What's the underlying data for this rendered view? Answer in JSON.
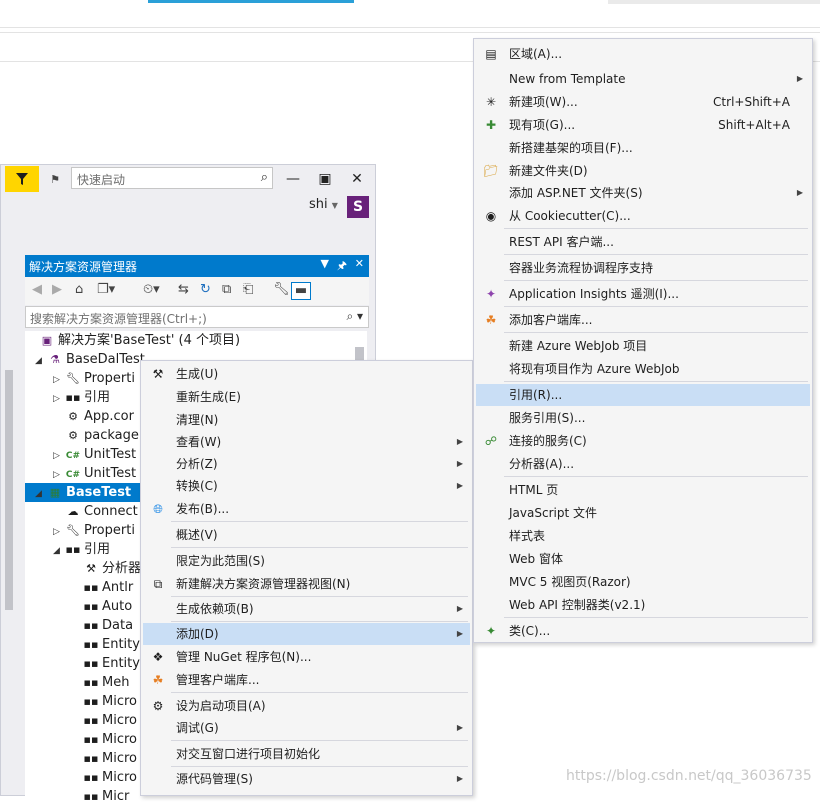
{
  "window": {
    "quick_launch_placeholder": "快速启动",
    "user_name": "shi",
    "avatar_letter": "S",
    "accent_color": "#007acc",
    "filter_color": "#ffd500"
  },
  "solution_explorer": {
    "title": "解决方案资源管理器",
    "search_placeholder": "搜索解决方案资源管理器(Ctrl+;)",
    "tree": [
      {
        "label": "解决方案'BaseTest' (4 个项目)",
        "icon": "solution-icon"
      },
      {
        "label": "BaseDalTest",
        "icon": "test-project-icon"
      },
      {
        "label": "Properti",
        "icon": "wrench-icon"
      },
      {
        "label": "引用",
        "icon": "references-icon"
      },
      {
        "label": "App.cor",
        "icon": "config-icon"
      },
      {
        "label": "package",
        "icon": "config-icon"
      },
      {
        "label": "UnitTest",
        "icon": "csharp-icon"
      },
      {
        "label": "UnitTest",
        "icon": "csharp-icon"
      },
      {
        "label": "BaseTest",
        "icon": "web-project-icon"
      },
      {
        "label": "Connect",
        "icon": "connected-services-icon"
      },
      {
        "label": "Properti",
        "icon": "wrench-icon"
      },
      {
        "label": "引用",
        "icon": "references-icon"
      },
      {
        "label": "分析器",
        "icon": "analyzer-icon"
      },
      {
        "label": "Antlr",
        "icon": "assembly-icon"
      },
      {
        "label": "Auto",
        "icon": "assembly-icon"
      },
      {
        "label": "Data",
        "icon": "assembly-icon"
      },
      {
        "label": "Entity",
        "icon": "assembly-icon"
      },
      {
        "label": "Entity",
        "icon": "assembly-icon"
      },
      {
        "label": "Meh",
        "icon": "assembly-icon"
      },
      {
        "label": "Micro",
        "icon": "assembly-icon"
      },
      {
        "label": "Micro",
        "icon": "assembly-icon"
      },
      {
        "label": "Micro",
        "icon": "assembly-icon"
      },
      {
        "label": "Micro",
        "icon": "assembly-icon"
      },
      {
        "label": "Micro",
        "icon": "assembly-icon"
      },
      {
        "label": "Micr",
        "icon": "assembly-icon"
      }
    ]
  },
  "context_menu": {
    "items": [
      {
        "label": "生成(U)",
        "icon": "build-icon"
      },
      {
        "label": "重新生成(E)"
      },
      {
        "label": "清理(N)"
      },
      {
        "label": "查看(W)",
        "submenu": true
      },
      {
        "label": "分析(Z)",
        "submenu": true
      },
      {
        "label": "转换(C)",
        "submenu": true
      },
      {
        "label": "发布(B)...",
        "icon": "publish-icon"
      },
      {
        "label": "概述(V)"
      },
      {
        "label": "限定为此范围(S)"
      },
      {
        "label": "新建解决方案资源管理器视图(N)",
        "icon": "new-view-icon"
      },
      {
        "label": "生成依赖项(B)",
        "submenu": true
      },
      {
        "label": "添加(D)",
        "submenu": true,
        "highlighted": true
      },
      {
        "label": "管理 NuGet 程序包(N)...",
        "icon": "nuget-icon"
      },
      {
        "label": "管理客户端库...",
        "icon": "client-library-icon"
      },
      {
        "label": "设为启动项目(A)",
        "icon": "gear-icon"
      },
      {
        "label": "调试(G)",
        "submenu": true
      },
      {
        "label": "对交互窗口进行项目初始化"
      },
      {
        "label": "源代码管理(S)",
        "submenu": true
      }
    ]
  },
  "add_submenu": {
    "items": [
      {
        "label": "区域(A)...",
        "icon": "area-icon"
      },
      {
        "label": "New from Template",
        "submenu": true
      },
      {
        "label": "新建项(W)...",
        "shortcut": "Ctrl+Shift+A",
        "icon": "new-item-icon"
      },
      {
        "label": "现有项(G)...",
        "shortcut": "Shift+Alt+A",
        "icon": "existing-item-icon"
      },
      {
        "label": "新搭建基架的项目(F)..."
      },
      {
        "label": "新建文件夹(D)",
        "icon": "new-folder-icon"
      },
      {
        "label": "添加 ASP.NET 文件夹(S)",
        "submenu": true
      },
      {
        "label": "从 Cookiecutter(C)...",
        "icon": "cookiecutter-icon"
      },
      {
        "label": "REST API 客户端..."
      },
      {
        "label": "容器业务流程协调程序支持"
      },
      {
        "label": "Application Insights 遥测(I)...",
        "icon": "insights-icon"
      },
      {
        "label": "添加客户端库...",
        "icon": "client-library-icon"
      },
      {
        "label": "新建 Azure WebJob 项目"
      },
      {
        "label": "将现有项目作为 Azure WebJob"
      },
      {
        "label": "引用(R)...",
        "highlighted": true
      },
      {
        "label": "服务引用(S)..."
      },
      {
        "label": "连接的服务(C)",
        "icon": "connected-service-icon"
      },
      {
        "label": "分析器(A)..."
      },
      {
        "label": "HTML 页"
      },
      {
        "label": "JavaScript 文件"
      },
      {
        "label": "样式表"
      },
      {
        "label": "Web 窗体"
      },
      {
        "label": "MVC 5 视图页(Razor)"
      },
      {
        "label": "Web API 控制器类(v2.1)"
      },
      {
        "label": "类(C)...",
        "icon": "class-icon"
      }
    ]
  },
  "watermark": "https://blog.csdn.net/qq_36036735"
}
